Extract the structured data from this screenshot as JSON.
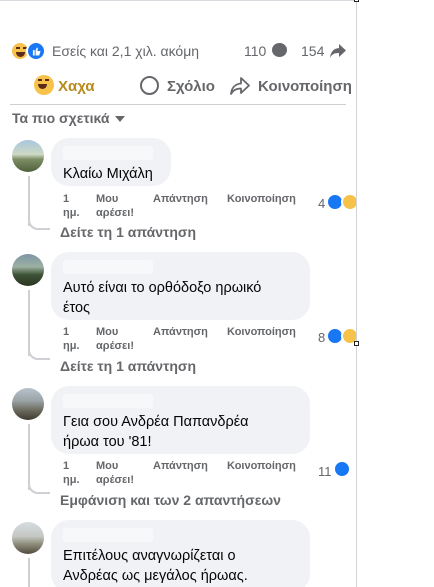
{
  "summary": {
    "reactions_text": "Εσείς και 2,1 χιλ. ακόμη",
    "comments_count": "110",
    "shares_count": "154",
    "reaction_icons": [
      "haha-icon",
      "like-icon"
    ]
  },
  "actions": {
    "reaction_label": "Χαχα",
    "comment_label": "Σχόλιο",
    "share_label": "Κοινοποίηση"
  },
  "sort": {
    "label": "Τα πιο σχετικά"
  },
  "comment_actions": {
    "time": "1",
    "time_unit": "ημ.",
    "like_line1": "Μου",
    "like_line2": "αρέσει!",
    "reply": "Απάντηση",
    "share": "Κοινοποίηση"
  },
  "comments": [
    {
      "text_lines": [
        "Κλαίω Μιχάλη"
      ],
      "reaction_count": "4",
      "replies": "Δείτε τη 1 απάντηση"
    },
    {
      "text_lines": [
        "Αυτό είναι το ορθόδοξο ηρωικό",
        "έτος"
      ],
      "reaction_count": "8",
      "replies": "Δείτε τη 1 απάντηση"
    },
    {
      "text_lines": [
        "Γεια σου Ανδρέα Παπανδρέα",
        "ήρωα του '81!"
      ],
      "reaction_count": "11",
      "replies": "Εμφάνιση και των 2 απαντήσεων"
    },
    {
      "text_lines": [
        "Επιτέλους αναγνωρίζεται ο",
        "Ανδρέας ως μεγάλος ήρωας."
      ]
    }
  ],
  "colors": {
    "secondary_text": "#65676b",
    "bubble_bg": "#f0f2f5",
    "like_blue": "#1877f2",
    "haha_yellow": "#f7c24a",
    "haha_label": "#b78a1c"
  }
}
